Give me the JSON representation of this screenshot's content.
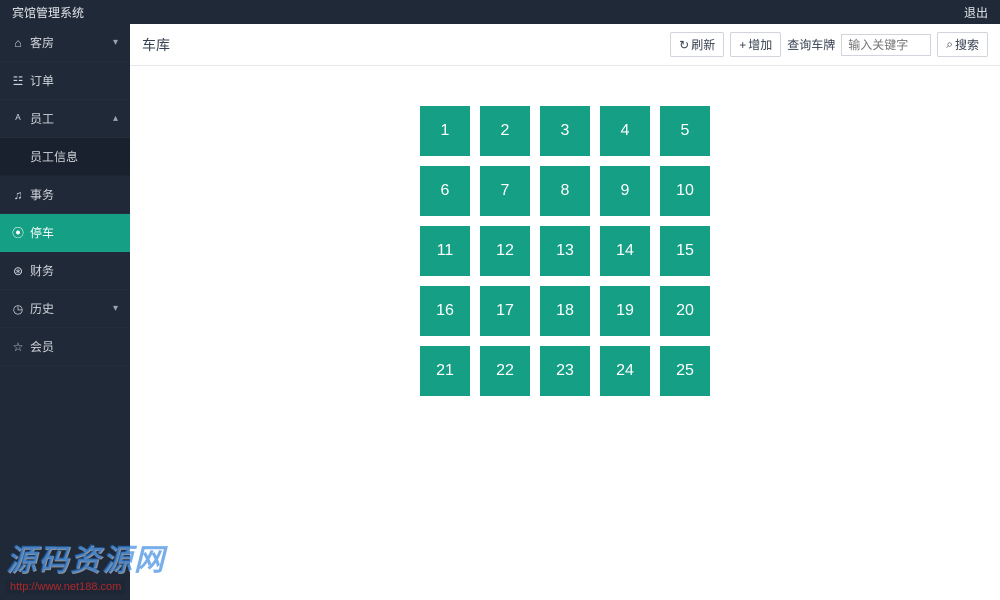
{
  "topbar": {
    "title": "宾馆管理系统",
    "logout": "退出"
  },
  "sidebar": {
    "items": [
      {
        "icon": "⌂",
        "label": "客房",
        "caret": "▾"
      },
      {
        "icon": "☳",
        "label": "订单"
      },
      {
        "icon": "ᴬ",
        "label": "员工",
        "caret": "▴"
      },
      {
        "icon": "",
        "label": "员工信息",
        "sub": true
      },
      {
        "icon": "♫",
        "label": "事务"
      },
      {
        "icon": "⦿",
        "label": "停车",
        "active": true
      },
      {
        "icon": "⊛",
        "label": "财务"
      },
      {
        "icon": "◷",
        "label": "历史",
        "caret": "▾"
      },
      {
        "icon": "☆",
        "label": "会员"
      }
    ]
  },
  "toolbar": {
    "title": "车库",
    "refresh_icon": "↻",
    "refresh_label": "刷新",
    "add_icon": "+",
    "add_label": "增加",
    "search_prefix": "查询车牌",
    "search_placeholder": "输入关键字",
    "search_icon": "⌕",
    "search_label": "搜索"
  },
  "spots": [
    "1",
    "2",
    "3",
    "4",
    "5",
    "6",
    "7",
    "8",
    "9",
    "10",
    "11",
    "12",
    "13",
    "14",
    "15",
    "16",
    "17",
    "18",
    "19",
    "20",
    "21",
    "22",
    "23",
    "24",
    "25"
  ],
  "watermark": {
    "main": "源码资源网",
    "sub": "http://www.net188.com"
  }
}
